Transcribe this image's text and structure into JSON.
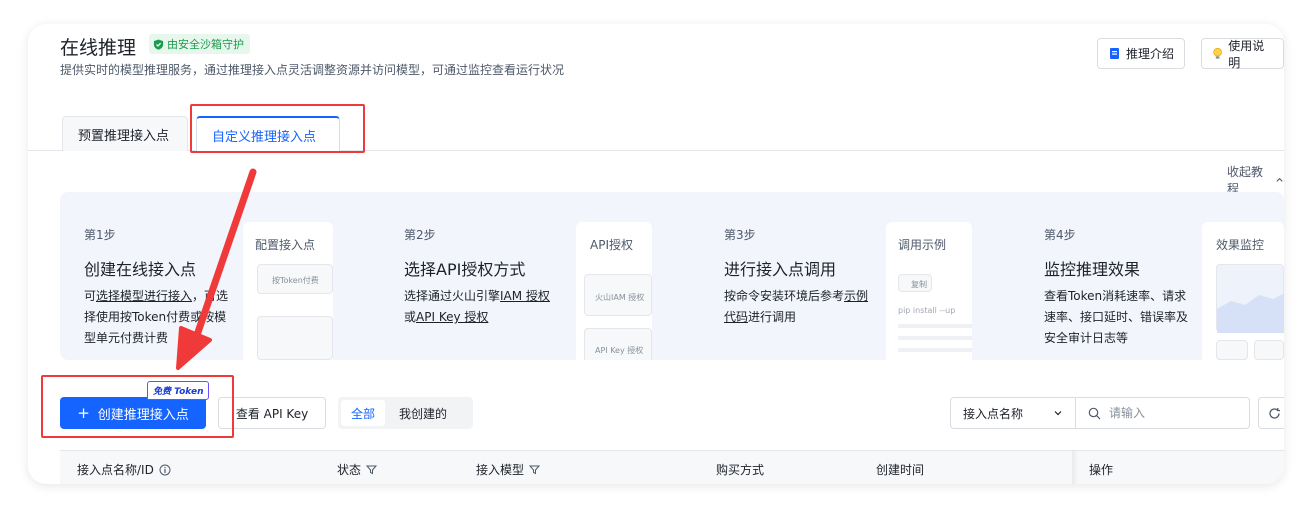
{
  "header": {
    "title": "在线推理",
    "badge": "由安全沙箱守护",
    "subtitle": "提供实时的模型推理服务，通过推理接入点灵活调整资源并访问模型，可通过监控查看运行状况",
    "intro_button": "推理介绍",
    "guide_button": "使用说明"
  },
  "tabs": [
    {
      "label": "预置推理接入点",
      "active": false
    },
    {
      "label": "自定义推理接入点",
      "active": true
    }
  ],
  "collapse_label": "收起教程",
  "steps": [
    {
      "no": "第1步",
      "title": "创建在线接入点",
      "desc_parts": [
        "可",
        "选择模型",
        "进行接入",
        "，可选择使用按Token付费或按模型单元付费计费"
      ],
      "preview_title": "配置接入点",
      "preview_item": "按Token付费"
    },
    {
      "no": "第2步",
      "title": "选择API授权方式",
      "desc_parts": [
        "选择通过火山引擎",
        "IAM 授权",
        "或",
        "API Key 授权"
      ],
      "preview_title": "API授权",
      "preview_item1": "火山IAM 授权",
      "preview_item2": "API Key 授权"
    },
    {
      "no": "第3步",
      "title": "进行接入点调用",
      "desc_parts": [
        "按命令安装环境后参考",
        "示例代码",
        "进行调用"
      ],
      "preview_title": "调用示例",
      "preview_copy": "复制",
      "preview_code": "pip install --up"
    },
    {
      "no": "第4步",
      "title": "监控推理效果",
      "desc": "查看Token消耗速率、请求速率、接口延时、错误率及安全审计日志等",
      "preview_title": "效果监控"
    }
  ],
  "toolbar": {
    "create_button": "创建推理接入点",
    "free_tag": "免费 Token",
    "view_api_key": "查看 API Key",
    "filter_all": "全部",
    "filter_mine": "我创建的",
    "filter_field": "接入点名称",
    "search_placeholder": "请输入"
  },
  "table": {
    "columns": [
      "接入点名称/ID",
      "状态",
      "接入模型",
      "购买方式",
      "创建时间",
      "操作"
    ]
  },
  "colors": {
    "primary": "#1664ff",
    "highlight_red": "#f03a3a",
    "badge_green": "#1a9c4a"
  }
}
